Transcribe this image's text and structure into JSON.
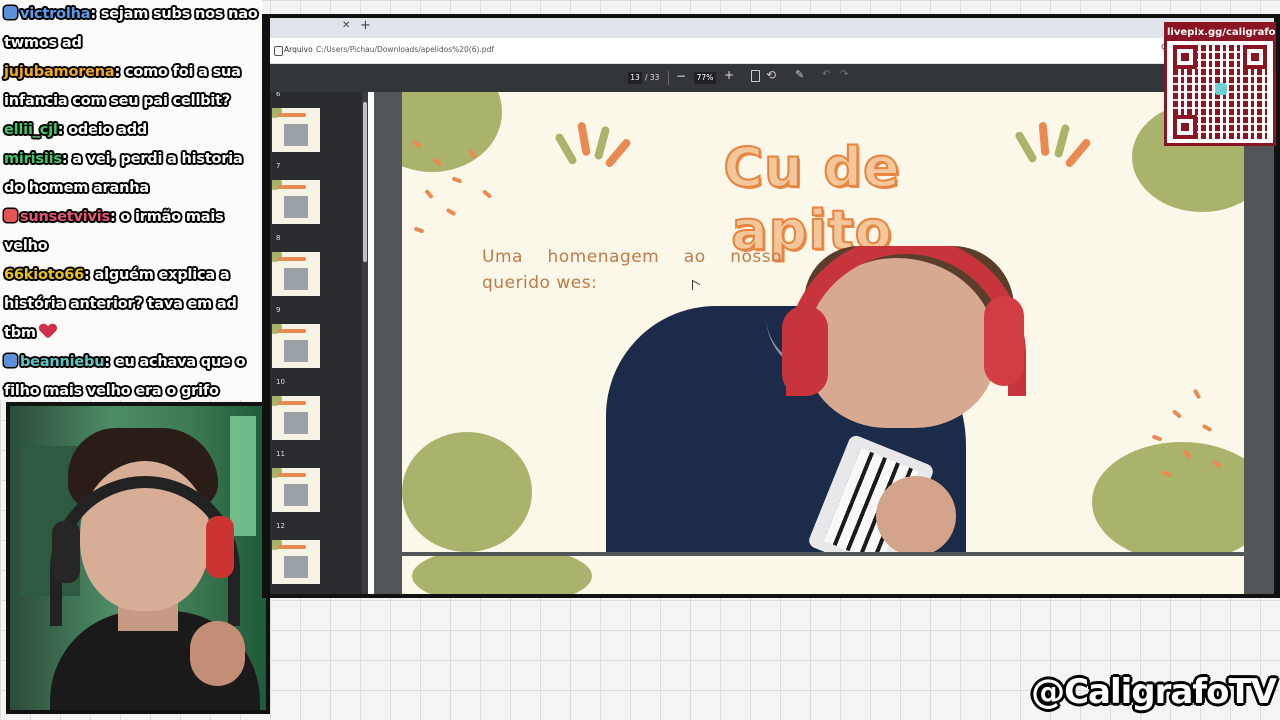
{
  "chat": {
    "messages": [
      {
        "user": "victrolha",
        "text": "sejam subs nos nao twmos ad",
        "user_color": "#5b9be8",
        "badge": true
      },
      {
        "user": "jujubamorena",
        "text": "como foi a sua infancia com seu pai cellbit?",
        "user_color": "#f2a91b",
        "badge": false
      },
      {
        "user": "ellii_cjl",
        "text": "odeio add",
        "user_color": "#3fc76b",
        "badge": false
      },
      {
        "user": "mirisiis",
        "text": "a vei, perdi a historia do homem aranha",
        "user_color": "#3fc76b",
        "badge": false
      },
      {
        "user": "sunsetvivis",
        "text": "o irmão mais velho",
        "user_color": "#e8547a",
        "badge": true
      },
      {
        "user": "66kioto66",
        "text": "alguém explica a história anterior? tava em ad tbm",
        "user_color": "#e8c21b",
        "badge": false,
        "heart": true
      },
      {
        "user": "beanniebu",
        "text": "eu achava que o filho mais velho era o grifo",
        "user_color": "#5fc7c3",
        "badge": true
      }
    ]
  },
  "browser": {
    "address_label": "Arquivo",
    "url": "C:/Users/Pichau/Downloads/apelidos%20(6).pdf",
    "icons": [
      "tab-close-icon",
      "new-tab-icon",
      "file-icon",
      "zoom-icon",
      "star-icon"
    ]
  },
  "pdf_toolbar": {
    "current_page": "13",
    "total_pages": "/ 33",
    "zoom": "77%",
    "minus": "−",
    "plus": "+"
  },
  "sidebar": {
    "page_numbers": [
      "6",
      "7",
      "8",
      "9",
      "10",
      "11",
      "12"
    ],
    "active_page": "13"
  },
  "slide": {
    "title": "Cu de apito",
    "text": "Uma homenagem ao nosso querido wes:"
  },
  "overlay": {
    "livepix_label": "livepix.gg/caligrafo",
    "handle": "@CaligrafoTV"
  },
  "colors": {
    "accent": "#e8843f",
    "olive": "#a9b36c",
    "slide_bg": "#fbf7e9",
    "brand_red": "#8a1523"
  }
}
